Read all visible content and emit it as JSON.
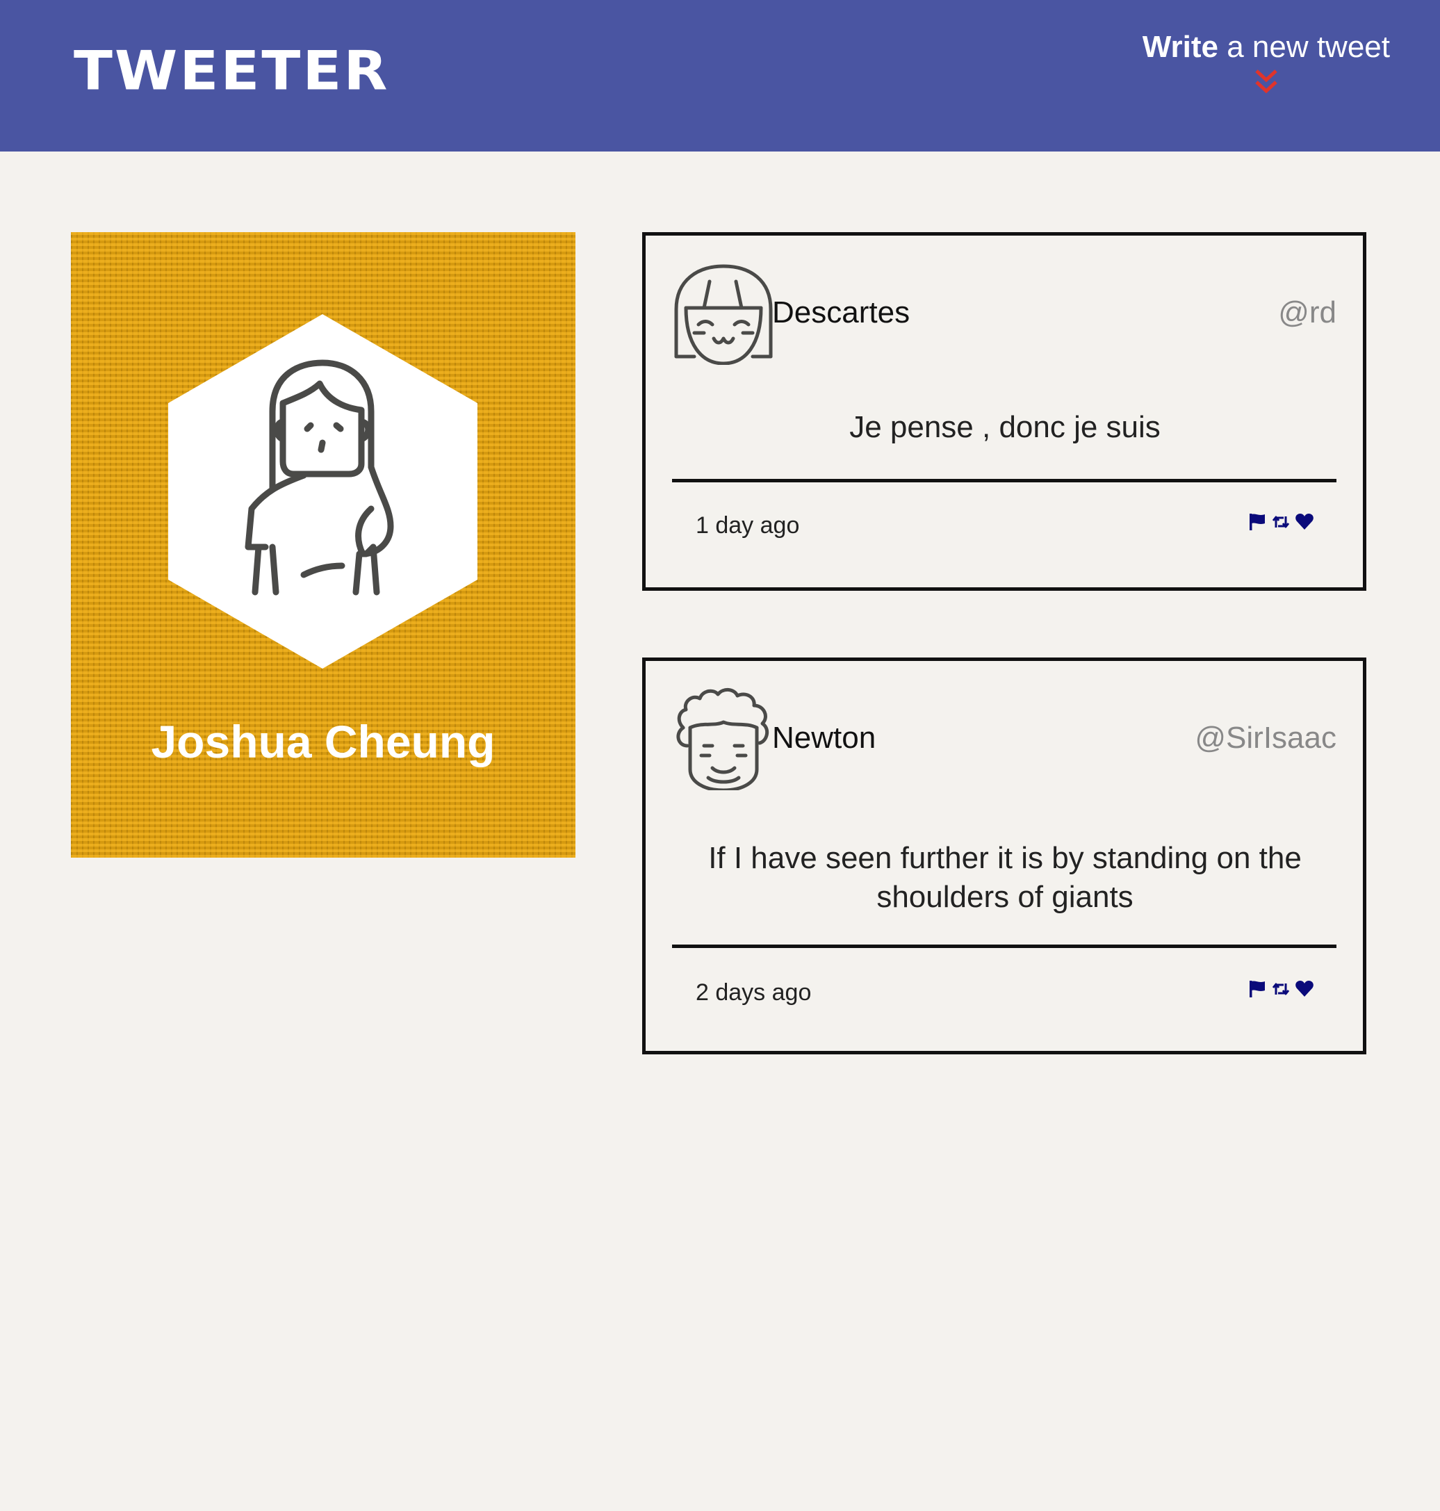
{
  "header": {
    "logo": "TWEETER",
    "compose_strong": "Write",
    "compose_rest": " a new tweet",
    "compose_icon": "double-chevron-down-icon",
    "background_color": "#4a55a2",
    "chevron_color": "#e0342b"
  },
  "profile": {
    "name": "Joshua Cheung",
    "avatar_icon": "user-avatar-icon",
    "background_color": "#d69a10"
  },
  "tweets": [
    {
      "name": "Descartes",
      "handle": "@rd",
      "text": "Je pense , donc je suis",
      "time": "1 day ago",
      "avatar_icon": "avatar-icon",
      "actions": [
        "flag-icon",
        "retweet-icon",
        "heart-icon"
      ]
    },
    {
      "name": "Newton",
      "handle": "@SirIsaac",
      "text": "If I have seen further it is by standing on the shoulders of giants",
      "time": "2 days ago",
      "avatar_icon": "avatar-icon",
      "actions": [
        "flag-icon",
        "retweet-icon",
        "heart-icon"
      ]
    }
  ],
  "colors": {
    "page_background": "#f4f2ee",
    "action_icons": "#0a0a7a"
  }
}
